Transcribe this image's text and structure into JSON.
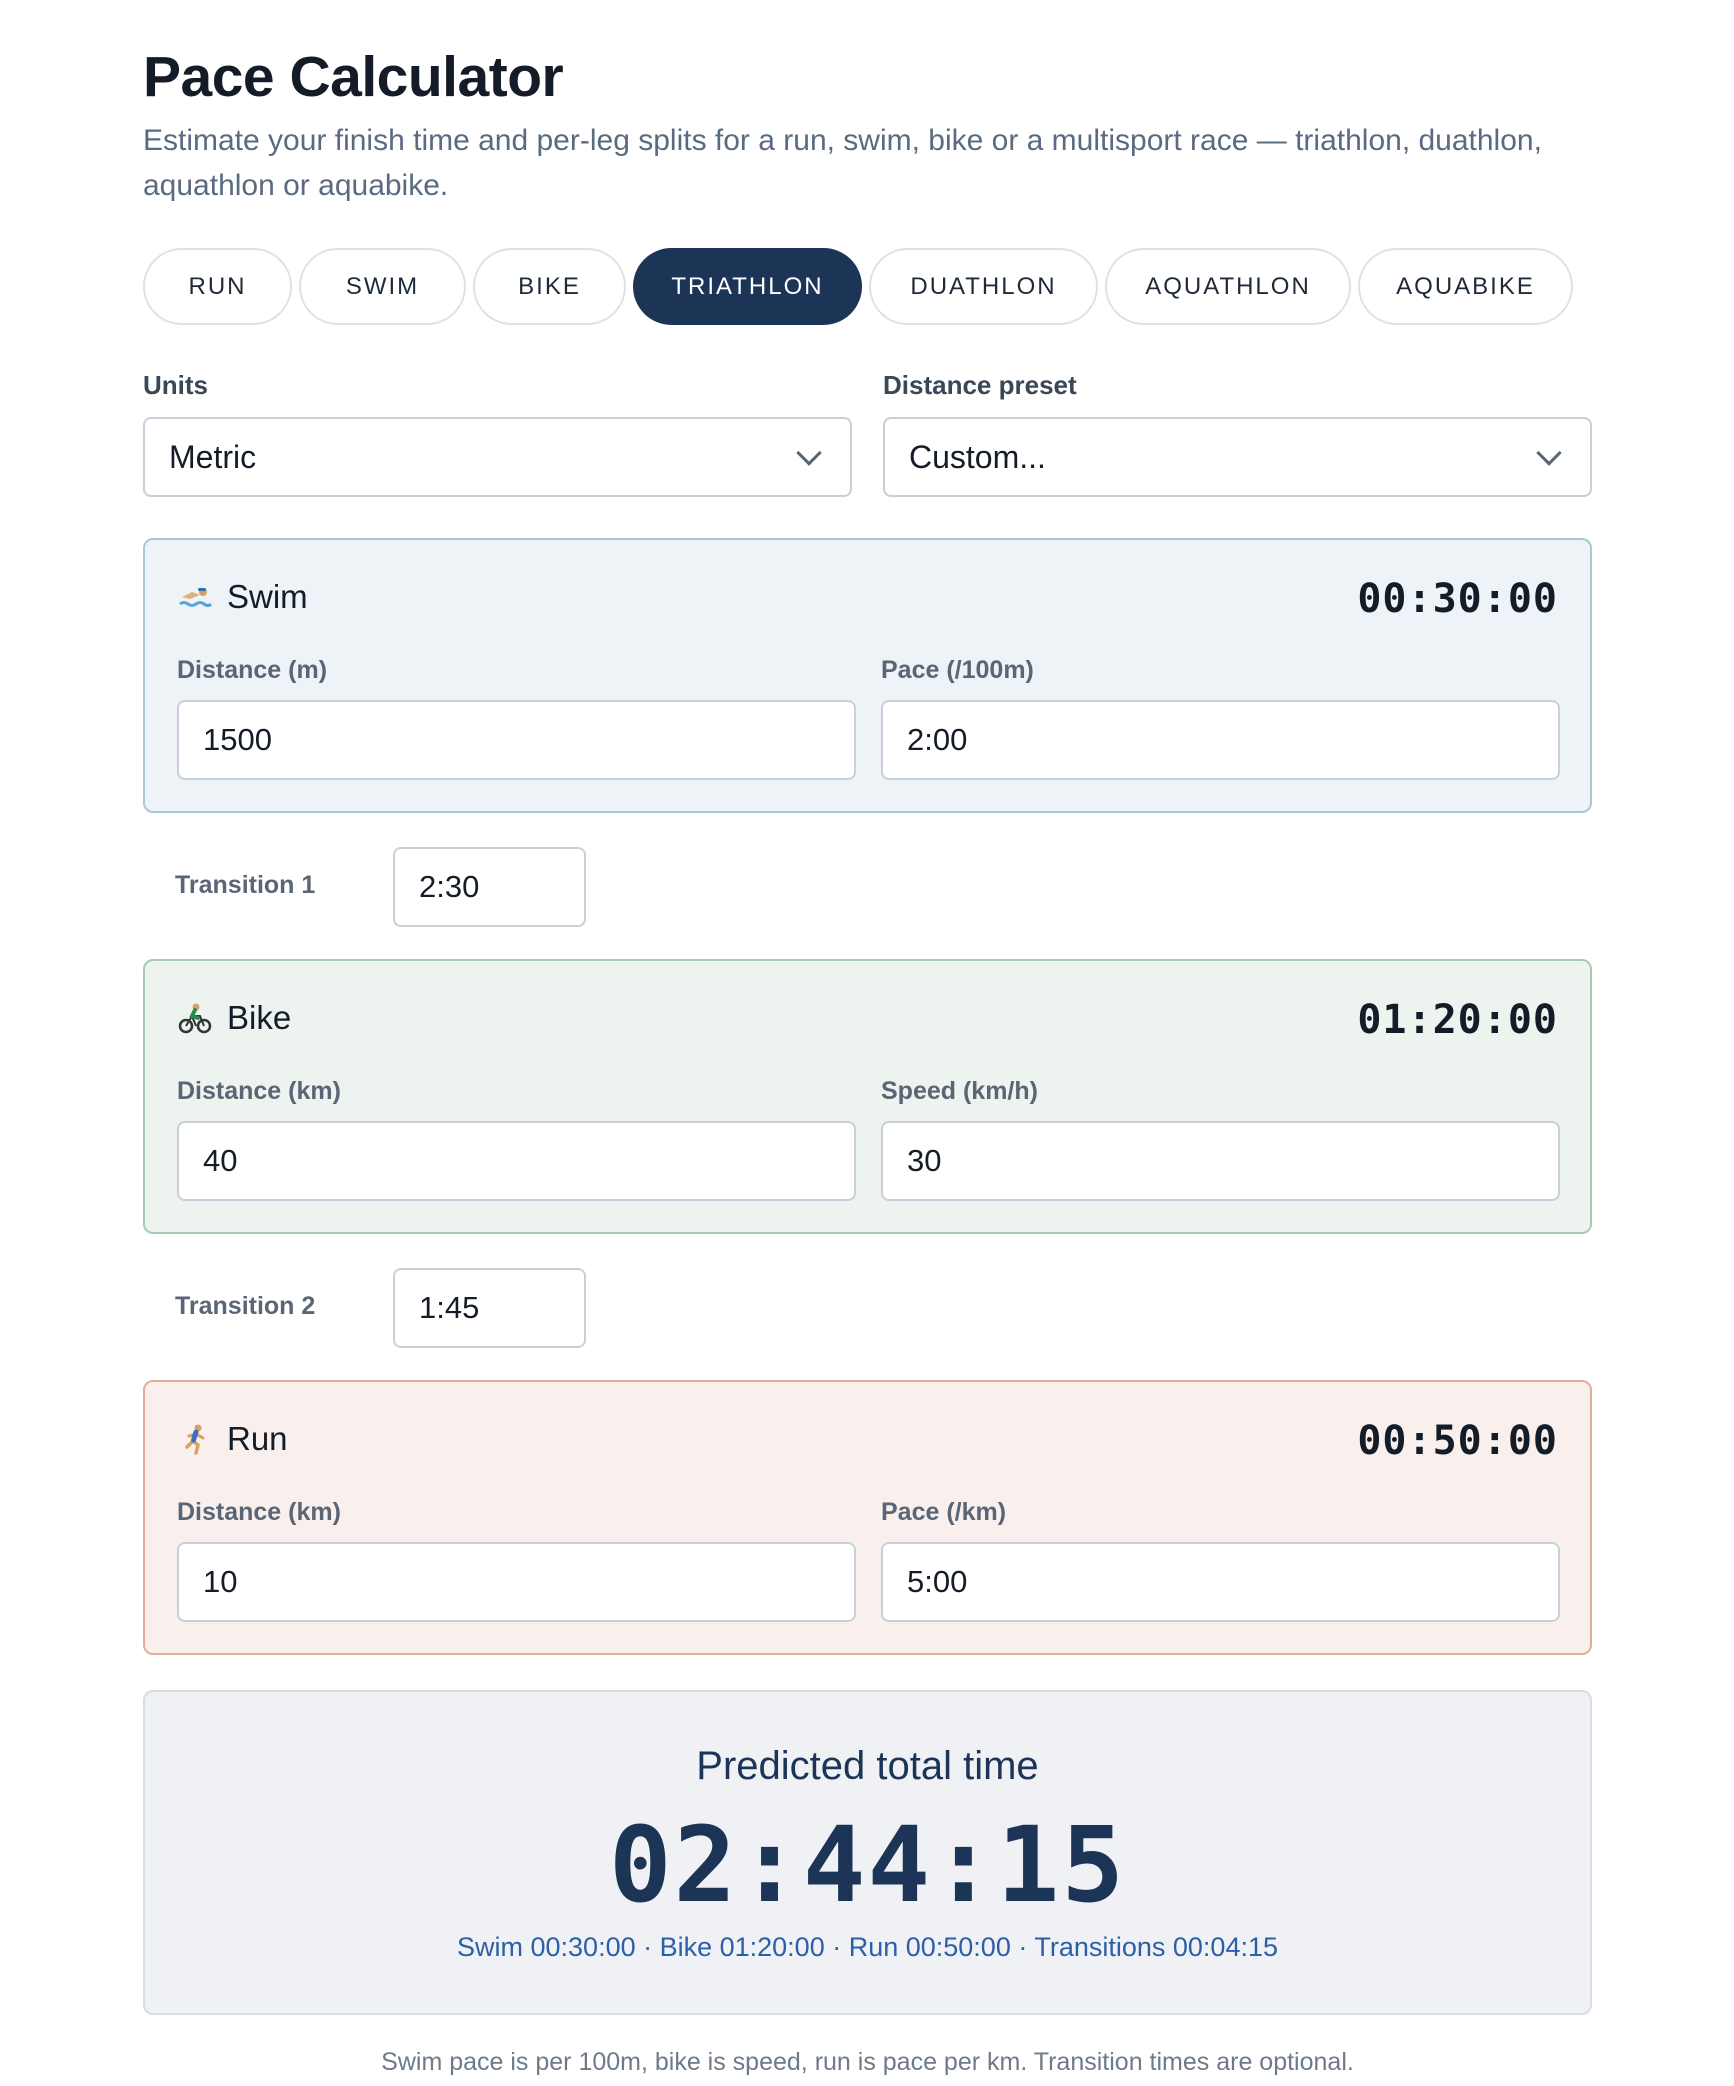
{
  "page": {
    "title": "Pace Calculator",
    "subtitle": "Estimate your finish time and per-leg splits for a run, swim, bike or a multisport race — triathlon, duathlon, aquathlon or aquabike."
  },
  "tabs": [
    {
      "label": "RUN",
      "active": false
    },
    {
      "label": "SWIM",
      "active": false
    },
    {
      "label": "BIKE",
      "active": false
    },
    {
      "label": "TRIATHLON",
      "active": true
    },
    {
      "label": "DUATHLON",
      "active": false
    },
    {
      "label": "AQUATHLON",
      "active": false
    },
    {
      "label": "AQUABIKE",
      "active": false
    }
  ],
  "units": {
    "label": "Units",
    "value": "Metric"
  },
  "preset": {
    "label": "Distance preset",
    "value": "Custom..."
  },
  "legs": {
    "swim": {
      "icon": "swimmer-icon",
      "name": "Swim",
      "time": "00:30:00",
      "distance_label": "Distance (m)",
      "distance_value": "1500",
      "pace_label": "Pace (/100m)",
      "pace_value": "2:00"
    },
    "bike": {
      "icon": "cyclist-icon",
      "name": "Bike",
      "time": "01:20:00",
      "distance_label": "Distance (km)",
      "distance_value": "40",
      "pace_label": "Speed (km/h)",
      "pace_value": "30"
    },
    "run": {
      "icon": "runner-icon",
      "name": "Run",
      "time": "00:50:00",
      "distance_label": "Distance (km)",
      "distance_value": "10",
      "pace_label": "Pace (/km)",
      "pace_value": "5:00"
    }
  },
  "transitions": [
    {
      "label": "Transition 1",
      "value": "2:30"
    },
    {
      "label": "Transition 2",
      "value": "1:45"
    }
  ],
  "result": {
    "label": "Predicted total time",
    "time": "02:44:15",
    "splits": "Swim 00:30:00 · Bike 01:20:00 · Run 00:50:00 · Transitions 00:04:15"
  },
  "note": "Swim pace is per 100m, bike is speed, run is pace per km. Transition times are optional.",
  "colors": {
    "accent": "#1c3557",
    "swim_bg": "#edf3f6",
    "bike_bg": "#edf4ef",
    "run_bg": "#f9f0ee",
    "splits_text": "#2d5fa8"
  }
}
